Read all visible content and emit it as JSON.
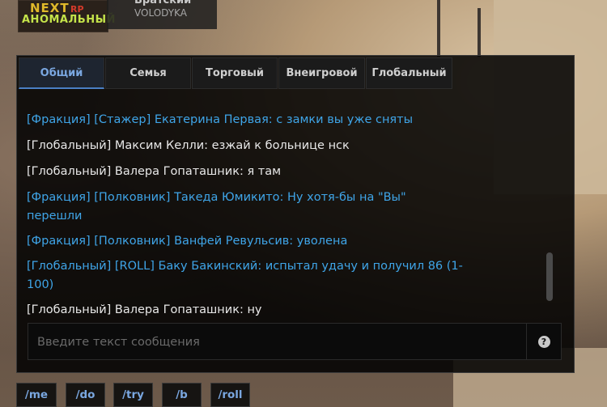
{
  "brand": {
    "logo_top": "NEXT",
    "logo_rp": "RP",
    "logo_bottom": "АНОМАЛЬНЫЙ"
  },
  "server": {
    "name": "Братский",
    "user": "VOLODYKA"
  },
  "chat": {
    "tabs": [
      {
        "label": "Общий",
        "active": true
      },
      {
        "label": "Семья",
        "active": false
      },
      {
        "label": "Торговый",
        "active": false
      },
      {
        "label": "Внеигровой",
        "active": false
      },
      {
        "label": "Глобальный",
        "active": false
      }
    ],
    "messages": [
      {
        "text": "[Фракция] [Стажер] Екатерина Первая: с замки вы уже сняты",
        "color": "#3fa5e8"
      },
      {
        "text": "[Глобальный] Максим Келли: езжай к больнице нск",
        "color": "#e8e8e8"
      },
      {
        "text": "[Глобальный] Валера Гопаташник: я там",
        "color": "#e8e8e8"
      },
      {
        "text": "[Фракция] [Полковник] Такеда Юмикито: Ну хотя-бы на \"Вы\" перешли",
        "color": "#3fa5e8"
      },
      {
        "text": "[Фракция] [Полковник] Ванфей Ревульсив: уволена",
        "color": "#3fa5e8"
      },
      {
        "text": "[Глобальный] [ROLL] Баку Бакинский:  испытал удачу и получил 86 (1-100)",
        "color": "#3fa5e8"
      },
      {
        "text": "[Глобальный] Валера Гопаташник: ну",
        "color": "#e8e8e8"
      }
    ],
    "input_placeholder": "Введите текст сообщения",
    "help_icon": "question-circle-icon",
    "help_glyph": "?"
  },
  "commands": [
    "/me",
    "/do",
    "/try",
    "/b",
    "/roll"
  ],
  "colors": {
    "accent": "#7aa7e0",
    "faction": "#3fa5e8",
    "global": "#e8e8e8"
  }
}
